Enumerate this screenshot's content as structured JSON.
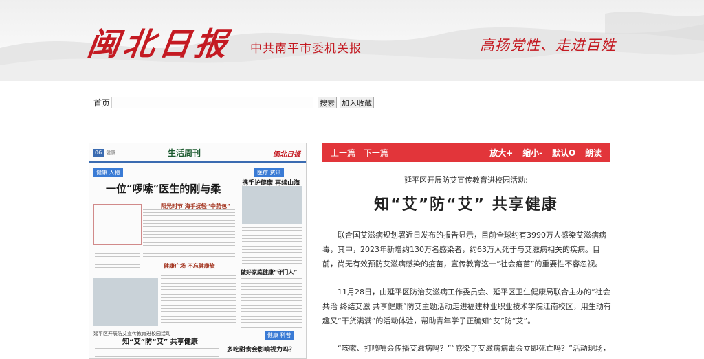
{
  "header": {
    "logo_text": "闽北日报",
    "subtitle": "中共南平市委机关报",
    "slogan": "高扬党性、走进百姓"
  },
  "nav": {
    "home_label": "首页",
    "search_value": "",
    "search_button": "搜索",
    "favorite_button": "加入收藏"
  },
  "paper_thumb": {
    "page_no": "06",
    "page_name": "健康",
    "weekly_title": "生活周刊",
    "logo": "闽北日报",
    "tag_left": "健康 人物",
    "headline_left": "一位“啰嗦”医生的刚与柔",
    "tag_right": "医疗 资讯",
    "headline_right": "携手护健康  再续山海情",
    "section_1": "阳光时节  海手抚轻“中药包”",
    "section_2": "健康广场  不忘健康旅",
    "section_3": "做好家庭健康“守门人”",
    "caption": "延平区开展防艾宣传教育进校园活动",
    "headline_bottom": "知“艾”防“艾”  共享健康",
    "tag_bottom": "健康 科普",
    "headline_bottom_right": "多吃甜食会影响视力吗？"
  },
  "article": {
    "toolbar": {
      "prev": "上一篇",
      "next": "下一篇",
      "zoom_in": "放大+",
      "zoom_out": "缩小-",
      "default": "默认O",
      "read": "朗读"
    },
    "subtitle": "延平区开展防艾宣传教育进校园活动:",
    "title": "知“艾”防“艾” 共享健康",
    "paragraphs": [
      "联合国艾滋病规划署近日发布的报告显示，目前全球约有3990万人感染艾滋病病毒，其中，2023年新增约130万名感染者，约63万人死于与艾滋病相关的疾病。目前，尚无有效预防艾滋病感染的疫苗，宣传教育这一“社会疫苗”的重要性不容忽视。",
      "11月28日，由延平区防治艾滋病工作委员会、延平区卫生健康局联合主办的“社会共治 终结艾滋 共享健康”防艾主题活动走进福建林业职业技术学院江南校区，用生动有趣又“干货满满”的活动体验，帮助青年学子正确知“艾”防“艾”。",
      "“咳嗽、打喷嚏会传播艾滋病吗？”“感染了艾滋病病毒会立即死亡吗？”活动现场，"
    ]
  },
  "colors": {
    "brand_red": "#c41a22",
    "toolbar_red": "#e2353a",
    "divider_blue": "#6b8cc0"
  }
}
